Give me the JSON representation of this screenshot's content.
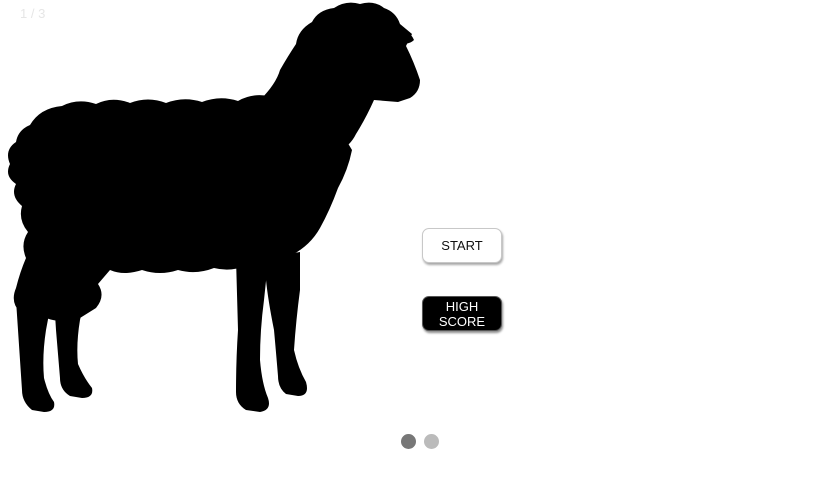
{
  "slide_counter": "1 / 3",
  "image": {
    "icon": "sheep-silhouette-icon",
    "color": "#000000"
  },
  "buttons": {
    "start_label": "START",
    "high_score_label": "HIGH SCORE"
  },
  "pagination": {
    "dots": [
      {
        "state": "active",
        "color": "#777777"
      },
      {
        "state": "inactive",
        "color": "#bbbbbb"
      }
    ]
  }
}
